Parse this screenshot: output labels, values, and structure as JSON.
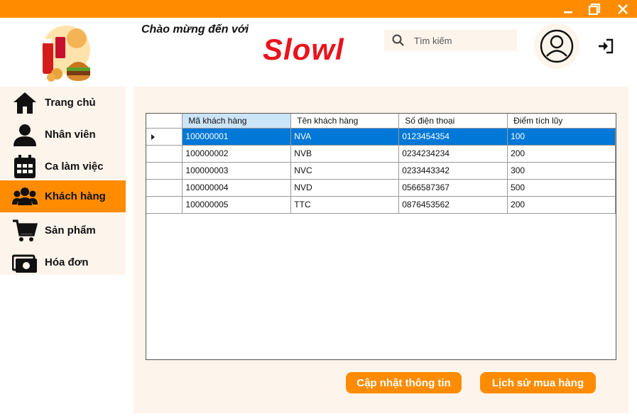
{
  "window": {
    "controls": [
      "minimize",
      "maximize",
      "close"
    ]
  },
  "header": {
    "welcome": "Chào mừng đến với",
    "brand": "Slowl",
    "search": {
      "placeholder": "Tìm kiếm",
      "value": ""
    }
  },
  "sidebar": {
    "items": [
      {
        "label": "Trang chủ",
        "icon": "home-icon",
        "active": false
      },
      {
        "label": "Nhân viên",
        "icon": "user-icon",
        "active": false
      },
      {
        "label": "Ca làm việc",
        "icon": "calendar-icon",
        "active": false
      },
      {
        "label": "Khách hàng",
        "icon": "users-icon",
        "active": true
      },
      {
        "label": "Sản phẩm",
        "icon": "cart-icon",
        "active": false
      },
      {
        "label": "Hóa đơn",
        "icon": "invoice-icon",
        "active": false
      }
    ]
  },
  "table": {
    "columns": [
      "Mã khách hàng",
      "Tên khách hàng",
      "Số điện thoại",
      "Điểm tích lũy"
    ],
    "rows": [
      [
        "100000001",
        "NVA",
        "0123454354",
        "100"
      ],
      [
        "100000002",
        "NVB",
        "0234234234",
        "200"
      ],
      [
        "100000003",
        "NVC",
        "0233443342",
        "300"
      ],
      [
        "100000004",
        "NVD",
        "0566587367",
        "500"
      ],
      [
        "100000005",
        "TTC",
        "0876453562",
        "200"
      ]
    ],
    "selected_row": 0
  },
  "actions": {
    "update": "Cập nhật thông tin",
    "history": "Lịch sử mua hàng"
  },
  "colors": {
    "accent": "#ff8c00",
    "panel": "#fdf5ec",
    "brand": "#e8141c",
    "selection": "#0078d7"
  }
}
